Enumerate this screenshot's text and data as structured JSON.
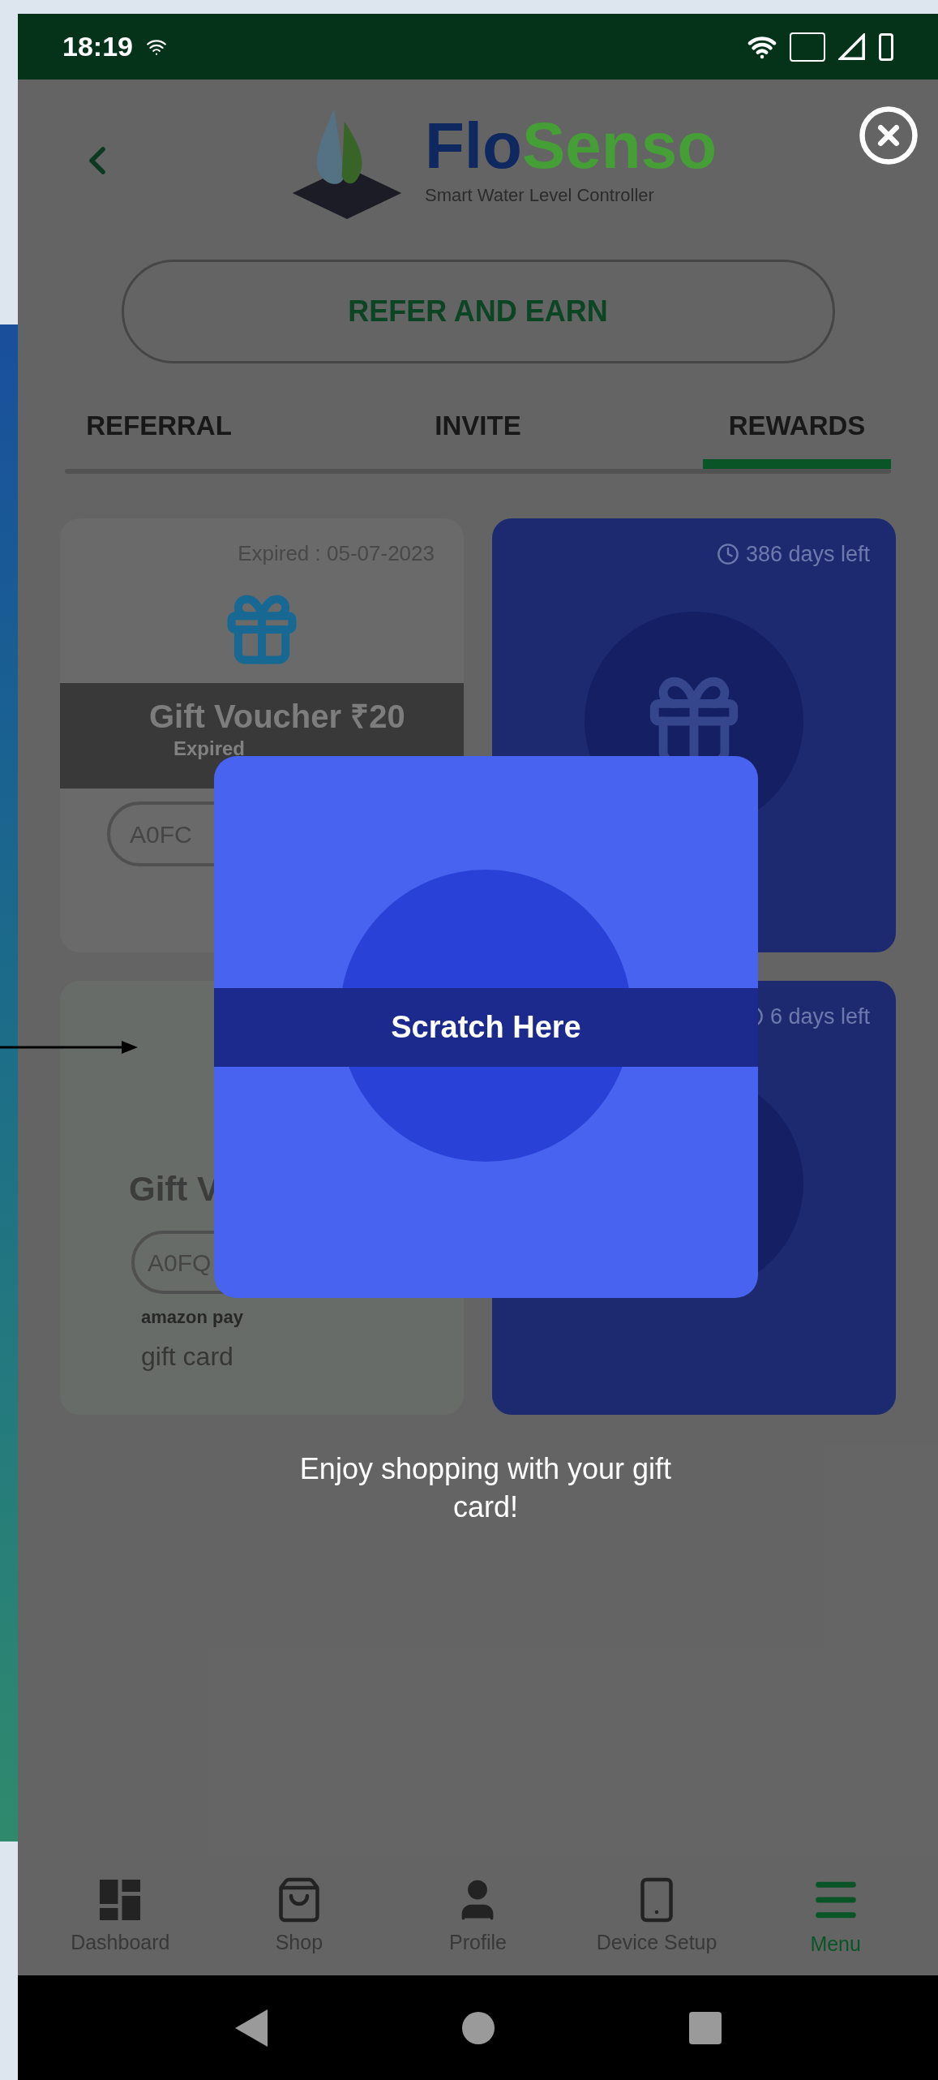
{
  "status_bar": {
    "time": "18:19"
  },
  "header": {
    "brand_first": "Flo",
    "brand_second": "Senso",
    "tagline": "Smart Water Level Controller"
  },
  "refer_button": "REFER AND EARN",
  "tabs": [
    {
      "label": "REFERRAL",
      "selected": false
    },
    {
      "label": "INVITE",
      "selected": false
    },
    {
      "label": "REWARDS",
      "selected": true
    }
  ],
  "rewards": [
    {
      "kind": "expired",
      "expiry": "Expired : 05-07-2023",
      "title": "Gift Voucher ₹20",
      "banner": "Expired",
      "code": "A0FC"
    },
    {
      "kind": "locked",
      "days_left": "386 days left"
    },
    {
      "kind": "unlocked",
      "title": "Gift V",
      "code": "A0FQ",
      "brand": "amazon pay",
      "caption": "gift card"
    },
    {
      "kind": "locked",
      "days_left": "6 days left"
    }
  ],
  "scratch_modal": {
    "label": "Scratch Here",
    "message": "Enjoy shopping with your gift card!"
  },
  "bottom_nav": [
    {
      "label": "Dashboard",
      "selected": false
    },
    {
      "label": "Shop",
      "selected": false
    },
    {
      "label": "Profile",
      "selected": false
    },
    {
      "label": "Device Setup",
      "selected": false
    },
    {
      "label": "Menu",
      "selected": true
    }
  ]
}
